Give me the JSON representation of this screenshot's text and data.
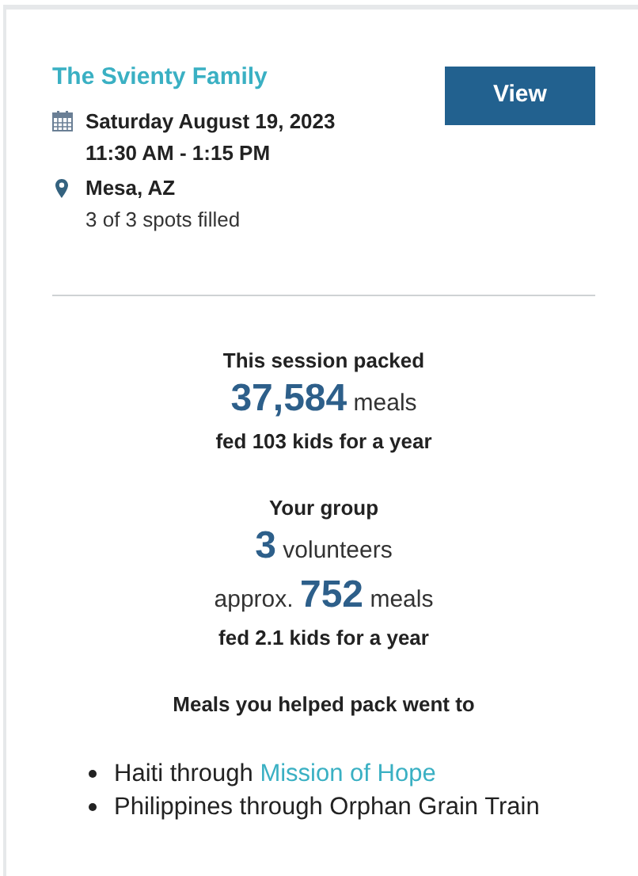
{
  "event": {
    "title": "The Svienty Family",
    "date": "Saturday August 19, 2023",
    "time": "11:30 AM - 1:15 PM",
    "location": "Mesa, AZ",
    "spots": "3 of 3 spots filled"
  },
  "view_button": "View",
  "session": {
    "heading": "This session packed",
    "meals_count": "37,584",
    "meals_unit": "meals",
    "impact": "fed 103 kids for a year"
  },
  "group": {
    "heading": "Your group",
    "volunteers_count": "3",
    "volunteers_unit": "volunteers",
    "meals_prefix": "approx.",
    "meals_count": "752",
    "meals_unit": "meals",
    "impact": "fed 2.1 kids for a year"
  },
  "destinations": {
    "heading": "Meals you helped pack went to",
    "items": [
      {
        "text": "Haiti through",
        "link": "Mission of Hope"
      },
      {
        "text": "Philippines through Orphan Grain Train"
      }
    ]
  }
}
